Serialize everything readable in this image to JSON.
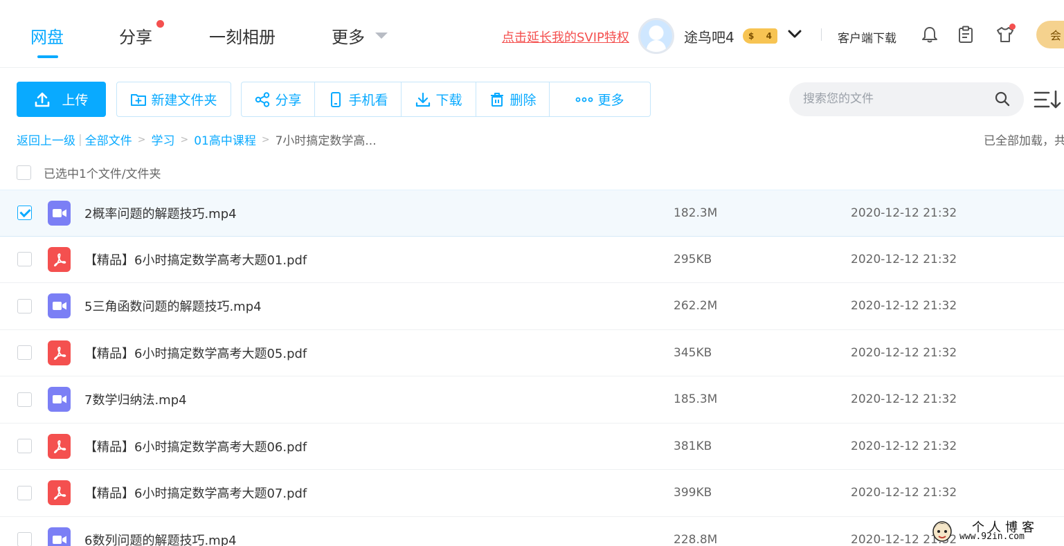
{
  "nav": {
    "tabs": [
      {
        "label": "网盘",
        "active": true
      },
      {
        "label": "分享",
        "dot": true
      },
      {
        "label": "一刻相册"
      },
      {
        "label": "更多"
      }
    ],
    "svip_link": "点击延长我的SVIP特权",
    "username": "途鸟吧4",
    "coin_symbol": "$",
    "coin_count": "4",
    "client_download": "客户端下载",
    "member_label": "会"
  },
  "toolbar": {
    "upload": "上传",
    "new_folder": "新建文件夹",
    "share": "分享",
    "phone_view": "手机看",
    "download": "下载",
    "delete": "删除",
    "more": "更多",
    "search_placeholder": "搜索您的文件"
  },
  "breadcrumb": {
    "back": "返回上一级",
    "items": [
      "全部文件",
      "学习",
      "01高中课程"
    ],
    "current": "7小时搞定数学高...",
    "status": "已全部加载，共"
  },
  "selection_text": "已选中1个文件/文件夹",
  "files": [
    {
      "name": "2概率问题的解题技巧.mp4",
      "type": "video",
      "size": "182.3M",
      "date": "2020-12-12 21:32",
      "selected": true
    },
    {
      "name": "【精品】6小时搞定数学高考大题01.pdf",
      "type": "pdf",
      "size": "295KB",
      "date": "2020-12-12 21:32"
    },
    {
      "name": "5三角函数问题的解题技巧.mp4",
      "type": "video",
      "size": "262.2M",
      "date": "2020-12-12 21:32"
    },
    {
      "name": "【精品】6小时搞定数学高考大题05.pdf",
      "type": "pdf",
      "size": "345KB",
      "date": "2020-12-12 21:32"
    },
    {
      "name": "7数学归纳法.mp4",
      "type": "video",
      "size": "185.3M",
      "date": "2020-12-12 21:32"
    },
    {
      "name": "【精品】6小时搞定数学高考大题06.pdf",
      "type": "pdf",
      "size": "381KB",
      "date": "2020-12-12 21:32"
    },
    {
      "name": "【精品】6小时搞定数学高考大题07.pdf",
      "type": "pdf",
      "size": "399KB",
      "date": "2020-12-12 21:32"
    },
    {
      "name": "6数列问题的解题技巧.mp4",
      "type": "video",
      "size": "228.8M",
      "date": "2020-12-12 21:32"
    }
  ],
  "watermark": {
    "title": "个人博客",
    "url": "www.92in.com"
  },
  "colors": {
    "accent": "#09aaff",
    "video_icon": "#7b7ff5",
    "pdf_icon": "#f4504f",
    "svip_red": "#f4504f"
  }
}
